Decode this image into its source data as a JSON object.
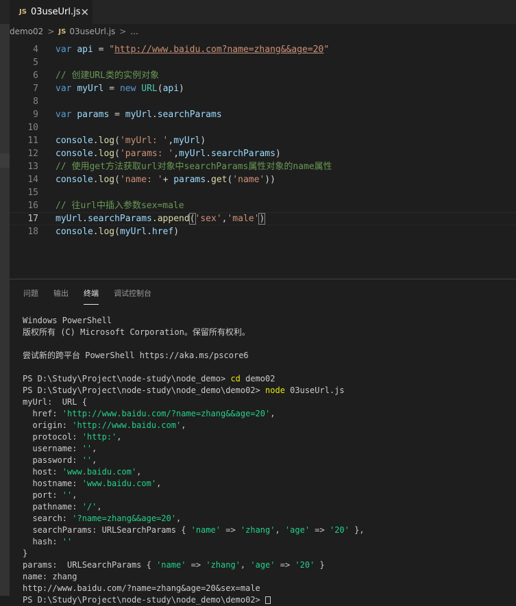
{
  "tab": {
    "icon": "JS",
    "title": "03useUrl.js",
    "close": "✕"
  },
  "breadcrumb": {
    "folder": "demo02",
    "sep": ">",
    "icon": "JS",
    "file": "03useUrl.js",
    "more": "..."
  },
  "editor": {
    "current_line": 17,
    "lines": [
      {
        "n": "4",
        "t": [
          [
            "kw",
            "var"
          ],
          [
            "p",
            " "
          ],
          [
            "v",
            "api"
          ],
          [
            "p",
            " = "
          ],
          [
            "s",
            "\""
          ],
          [
            "su",
            "http://www.baidu.com?name=zhang&&age=20"
          ],
          [
            "s",
            "\""
          ]
        ]
      },
      {
        "n": "5",
        "t": []
      },
      {
        "n": "6",
        "t": [
          [
            "c",
            "// 创建URL类的实例对象"
          ]
        ]
      },
      {
        "n": "7",
        "t": [
          [
            "kw",
            "var"
          ],
          [
            "p",
            " "
          ],
          [
            "v",
            "myUrl"
          ],
          [
            "p",
            " = "
          ],
          [
            "kw",
            "new"
          ],
          [
            "p",
            " "
          ],
          [
            "cl",
            "URL"
          ],
          [
            "p",
            "("
          ],
          [
            "v",
            "api"
          ],
          [
            "p",
            ")"
          ]
        ]
      },
      {
        "n": "8",
        "t": []
      },
      {
        "n": "9",
        "t": [
          [
            "kw",
            "var"
          ],
          [
            "p",
            " "
          ],
          [
            "v",
            "params"
          ],
          [
            "p",
            " = "
          ],
          [
            "v",
            "myUrl"
          ],
          [
            "p",
            "."
          ],
          [
            "v",
            "searchParams"
          ]
        ]
      },
      {
        "n": "10",
        "t": []
      },
      {
        "n": "11",
        "t": [
          [
            "v",
            "console"
          ],
          [
            "p",
            "."
          ],
          [
            "f",
            "log"
          ],
          [
            "p",
            "("
          ],
          [
            "s",
            "'myUrl: '"
          ],
          [
            "p",
            ","
          ],
          [
            "v",
            "myUrl"
          ],
          [
            "p",
            ")"
          ]
        ]
      },
      {
        "n": "12",
        "t": [
          [
            "v",
            "console"
          ],
          [
            "p",
            "."
          ],
          [
            "f",
            "log"
          ],
          [
            "p",
            "("
          ],
          [
            "s",
            "'params: '"
          ],
          [
            "p",
            ","
          ],
          [
            "v",
            "myUrl"
          ],
          [
            "p",
            "."
          ],
          [
            "v",
            "searchParams"
          ],
          [
            "p",
            ")"
          ]
        ]
      },
      {
        "n": "13",
        "t": [
          [
            "c",
            "// 使用get方法获取url对象中searchParams属性对象的name属性"
          ]
        ]
      },
      {
        "n": "14",
        "t": [
          [
            "v",
            "console"
          ],
          [
            "p",
            "."
          ],
          [
            "f",
            "log"
          ],
          [
            "p",
            "("
          ],
          [
            "s",
            "'name: '"
          ],
          [
            "p",
            "+ "
          ],
          [
            "v",
            "params"
          ],
          [
            "p",
            "."
          ],
          [
            "f",
            "get"
          ],
          [
            "p",
            "("
          ],
          [
            "s",
            "'name'"
          ],
          [
            "p",
            "))"
          ]
        ]
      },
      {
        "n": "15",
        "t": []
      },
      {
        "n": "16",
        "t": [
          [
            "c",
            "// 往url中插入参数sex=male"
          ]
        ]
      },
      {
        "n": "17",
        "t": [
          [
            "v",
            "myUrl"
          ],
          [
            "p",
            "."
          ],
          [
            "v",
            "searchParams"
          ],
          [
            "p",
            "."
          ],
          [
            "f",
            "append"
          ],
          [
            "pb",
            "("
          ],
          [
            "s",
            "'sex'"
          ],
          [
            "p",
            ","
          ],
          [
            "s",
            "'male'"
          ],
          [
            "pb",
            ")"
          ]
        ]
      },
      {
        "n": "18",
        "t": [
          [
            "v",
            "console"
          ],
          [
            "p",
            "."
          ],
          [
            "f",
            "log"
          ],
          [
            "p",
            "("
          ],
          [
            "v",
            "myUrl"
          ],
          [
            "p",
            "."
          ],
          [
            "v",
            "href"
          ],
          [
            "p",
            ")"
          ]
        ]
      }
    ]
  },
  "panel": {
    "tabs": [
      "问题",
      "输出",
      "终端",
      "调试控制台"
    ],
    "active_tab": "终端"
  },
  "terminal": [
    [
      [
        "t",
        "Windows PowerShell"
      ]
    ],
    [
      [
        "t",
        "版权所有 (C) Microsoft Corporation。保留所有权利。"
      ]
    ],
    [
      [
        "t",
        ""
      ]
    ],
    [
      [
        "t",
        "尝试新的跨平台 PowerShell https://aka.ms/pscore6"
      ]
    ],
    [
      [
        "t",
        ""
      ]
    ],
    [
      [
        "t",
        "PS D:\\Study\\Project\\node-study\\node_demo> "
      ],
      [
        "y",
        "cd"
      ],
      [
        "t",
        " demo02"
      ]
    ],
    [
      [
        "t",
        "PS D:\\Study\\Project\\node-study\\node_demo\\demo02> "
      ],
      [
        "y",
        "node"
      ],
      [
        "t",
        " 03useUrl.js"
      ]
    ],
    [
      [
        "t",
        "myUrl:  URL {"
      ]
    ],
    [
      [
        "t",
        "  href: "
      ],
      [
        "g",
        "'http://www.baidu.com/?name=zhang&&age=20'"
      ],
      [
        "t",
        ","
      ]
    ],
    [
      [
        "t",
        "  origin: "
      ],
      [
        "g",
        "'http://www.baidu.com'"
      ],
      [
        "t",
        ","
      ]
    ],
    [
      [
        "t",
        "  protocol: "
      ],
      [
        "g",
        "'http:'"
      ],
      [
        "t",
        ","
      ]
    ],
    [
      [
        "t",
        "  username: "
      ],
      [
        "g",
        "''"
      ],
      [
        "t",
        ","
      ]
    ],
    [
      [
        "t",
        "  password: "
      ],
      [
        "g",
        "''"
      ],
      [
        "t",
        ","
      ]
    ],
    [
      [
        "t",
        "  host: "
      ],
      [
        "g",
        "'www.baidu.com'"
      ],
      [
        "t",
        ","
      ]
    ],
    [
      [
        "t",
        "  hostname: "
      ],
      [
        "g",
        "'www.baidu.com'"
      ],
      [
        "t",
        ","
      ]
    ],
    [
      [
        "t",
        "  port: "
      ],
      [
        "g",
        "''"
      ],
      [
        "t",
        ","
      ]
    ],
    [
      [
        "t",
        "  pathname: "
      ],
      [
        "g",
        "'/'"
      ],
      [
        "t",
        ","
      ]
    ],
    [
      [
        "t",
        "  search: "
      ],
      [
        "g",
        "'?name=zhang&&age=20'"
      ],
      [
        "t",
        ","
      ]
    ],
    [
      [
        "t",
        "  searchParams: URLSearchParams { "
      ],
      [
        "g",
        "'name'"
      ],
      [
        "t",
        " => "
      ],
      [
        "g",
        "'zhang'"
      ],
      [
        "t",
        ", "
      ],
      [
        "g",
        "'age'"
      ],
      [
        "t",
        " => "
      ],
      [
        "g",
        "'20'"
      ],
      [
        "t",
        " },"
      ]
    ],
    [
      [
        "t",
        "  hash: "
      ],
      [
        "g",
        "''"
      ]
    ],
    [
      [
        "t",
        "}"
      ]
    ],
    [
      [
        "t",
        "params:  URLSearchParams { "
      ],
      [
        "g",
        "'name'"
      ],
      [
        "t",
        " => "
      ],
      [
        "g",
        "'zhang'"
      ],
      [
        "t",
        ", "
      ],
      [
        "g",
        "'age'"
      ],
      [
        "t",
        " => "
      ],
      [
        "g",
        "'20'"
      ],
      [
        "t",
        " }"
      ]
    ],
    [
      [
        "t",
        "name: zhang"
      ]
    ],
    [
      [
        "t",
        "http://www.baidu.com/?name=zhang&age=20&sex=male"
      ]
    ],
    [
      [
        "t",
        "PS D:\\Study\\Project\\node-study\\node_demo\\demo02> "
      ],
      [
        "cursor",
        ""
      ]
    ]
  ]
}
